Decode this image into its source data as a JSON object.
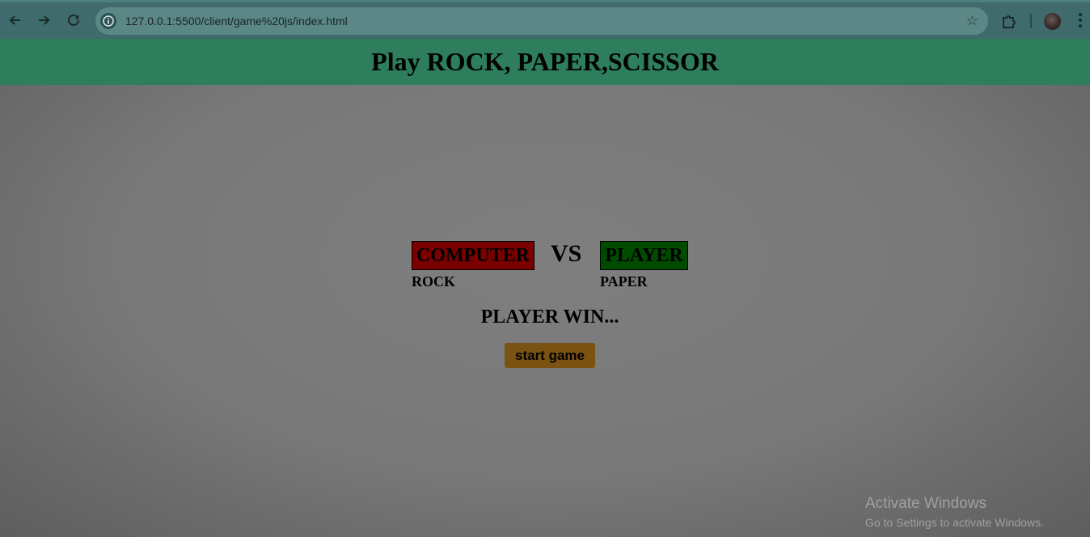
{
  "browser": {
    "url": "127.0.0.1:5500/client/game%20js/index.html",
    "icons": {
      "back": "arrow-left-icon",
      "forward": "arrow-right-icon",
      "reload": "reload-icon",
      "site_info": "info-icon",
      "bookmark": "star-icon",
      "extensions": "puzzle-icon",
      "menu": "kebab-menu-icon"
    }
  },
  "header": {
    "title": "Play ROCK, PAPER,SCISSOR",
    "background": "#2e7e5e"
  },
  "game": {
    "computer_label": "COMPUTER",
    "computer_color": "#7a0000",
    "vs_label": "VS",
    "player_label": "PLAYER",
    "player_color": "#004b00",
    "computer_choice": "ROCK",
    "player_choice": "PAPER",
    "result_text": "PLAYER WIN...",
    "start_button_label": "start game",
    "start_button_color": "#7a5211"
  },
  "watermark": {
    "title": "Activate Windows",
    "subtitle": "Go to Settings to activate Windows."
  }
}
